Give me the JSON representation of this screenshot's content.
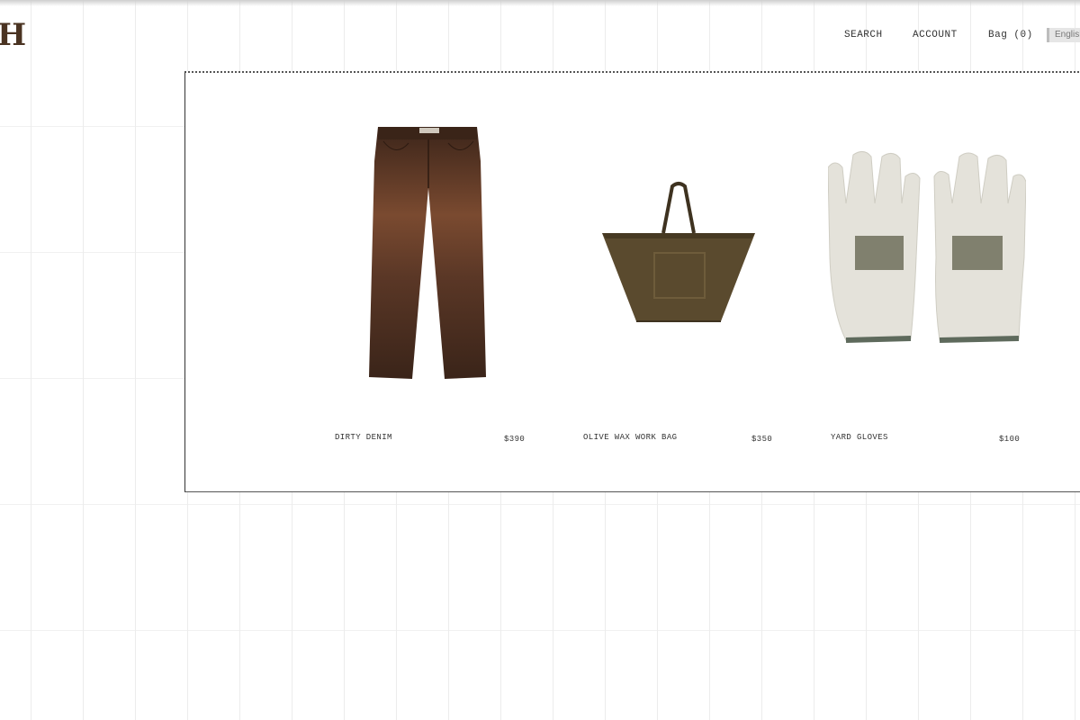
{
  "header": {
    "logo_text": "H",
    "nav": {
      "search": "SEARCH",
      "account": "ACCOUNT",
      "bag": "Bag (0)"
    },
    "language": "English"
  },
  "products": [
    {
      "name": "DIRTY DENIM",
      "price": "$390",
      "icon": "denim-jeans"
    },
    {
      "name": "OLIVE WAX WORK BAG",
      "price": "$350",
      "icon": "tote-bag"
    },
    {
      "name": "YARD GLOVES",
      "price": "$100",
      "icon": "work-gloves"
    }
  ],
  "colors": {
    "logo": "#4a3322",
    "denim": "#4e2f20",
    "bag": "#5a4a2e",
    "gloves": "#e4e2da",
    "glove_print": "#6f6f5a"
  }
}
